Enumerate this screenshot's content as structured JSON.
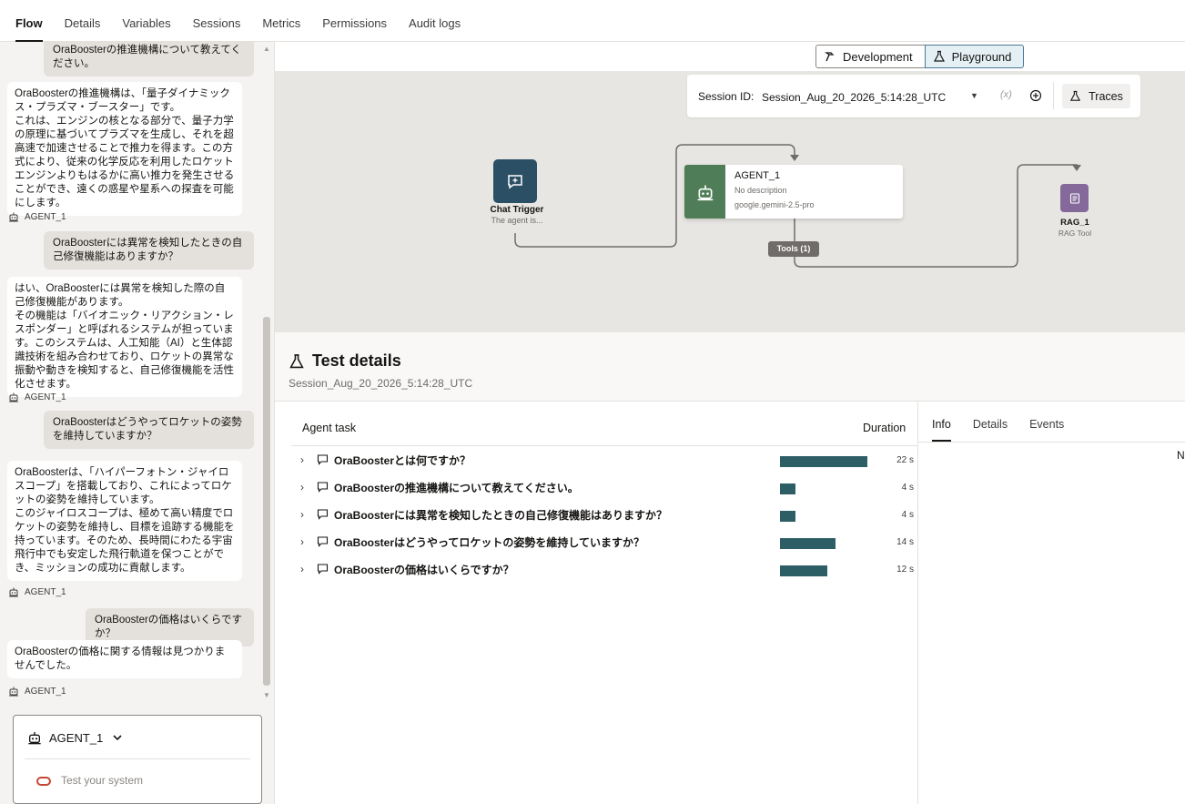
{
  "top_tabs": [
    "Flow",
    "Details",
    "Variables",
    "Sessions",
    "Metrics",
    "Permissions",
    "Audit logs"
  ],
  "chat": {
    "messages": [
      {
        "role": "user",
        "text": "OraBoosterの推進機構について教えてください。"
      },
      {
        "role": "agent",
        "text": "OraBoosterの推進機構は、「量子ダイナミックス・プラズマ・ブースター」です。\nこれは、エンジンの核となる部分で、量子力学の原理に基づいてプラズマを生成し、それを超高速で加速させることで推力を得ます。この方式により、従来の化学反応を利用したロケットエンジンよりもはるかに高い推力を発生させることができ、遠くの惑星や星系への探査を可能にします。"
      },
      {
        "role": "label",
        "text": "AGENT_1"
      },
      {
        "role": "user",
        "text": "OraBoosterには異常を検知したときの自己修復機能はありますか？"
      },
      {
        "role": "agent",
        "text": "はい、OraBoosterには異常を検知した際の自己修復機能があります。\nその機能は「バイオニック・リアクション・レスポンダー」と呼ばれるシステムが担っています。このシステムは、人工知能（AI）と生体認識技術を組み合わせており、ロケットの異常な振動や動きを検知すると、自己修復機能を活性化させます。"
      },
      {
        "role": "label",
        "text": "AGENT_1"
      },
      {
        "role": "user",
        "text": "OraBoosterはどうやってロケットの姿勢を維持していますか？"
      },
      {
        "role": "agent",
        "text": "OraBoosterは、「ハイパーフォトン・ジャイロスコープ」を搭載しており、これによってロケットの姿勢を維持しています。\nこのジャイロスコープは、極めて高い精度でロケットの姿勢を維持し、目標を追跡する機能を持っています。そのため、長時間にわたる宇宙飛行中でも安定した飛行軌道を保つことができ、ミッションの成功に貢献します。"
      },
      {
        "role": "label",
        "text": "AGENT_1"
      },
      {
        "role": "user",
        "text": "OraBoosterの価格はいくらですか？"
      },
      {
        "role": "agent",
        "text": "OraBoosterの価格に関する情報は見つかりませんでした。"
      },
      {
        "role": "label",
        "text": "AGENT_1"
      }
    ],
    "composer_agent": "AGENT_1",
    "input_placeholder": "Test your system",
    "input_value": ""
  },
  "mode": {
    "development": "Development",
    "playground": "Playground",
    "active": "Playground"
  },
  "session": {
    "label": "Session ID:",
    "value": "Session_Aug_20_2026_5:14:28_UTC",
    "clear_glyph": "(x)",
    "traces": "Traces"
  },
  "flow": {
    "trigger": {
      "title": "Chat Trigger",
      "subtitle": "The agent is..."
    },
    "agent": {
      "title": "AGENT_1",
      "description": "No description",
      "model": "google.gemini-2.5-pro"
    },
    "tools_badge": "Tools (1)",
    "rag": {
      "title": "RAG_1",
      "subtitle": "RAG Tool"
    }
  },
  "test_details": {
    "title": "Test details",
    "session": "Session_Aug_20_2026_5:14:28_UTC",
    "col_task": "Agent task",
    "col_duration": "Duration",
    "max_seconds": 22,
    "tasks": [
      {
        "text": "OraBoosterとは何ですか？",
        "duration": "22 s",
        "seconds": 22
      },
      {
        "text": "OraBoosterの推進機構について教えてください。",
        "duration": "4 s",
        "seconds": 4
      },
      {
        "text": "OraBoosterには異常を検知したときの自己修復機能はありますか？",
        "duration": "4 s",
        "seconds": 4
      },
      {
        "text": "OraBoosterはどうやってロケットの姿勢を維持していますか？",
        "duration": "14 s",
        "seconds": 14
      },
      {
        "text": "OraBoosterの価格はいくらですか？",
        "duration": "12 s",
        "seconds": 12
      }
    ],
    "side_tabs": [
      "Info",
      "Details",
      "Events"
    ],
    "side_active": "Info",
    "side_cutoff_text": "N"
  },
  "colors": {
    "accent_bar": "#2d5e66",
    "trigger": "#2b5065",
    "agent": "#4f7d57",
    "rag": "#85699a",
    "oracle_red": "#c74634"
  },
  "icons": {
    "agent": "robot-icon",
    "chat": "chat-bubble-icon",
    "flask": "flask-icon",
    "hammer": "hammer-icon"
  }
}
